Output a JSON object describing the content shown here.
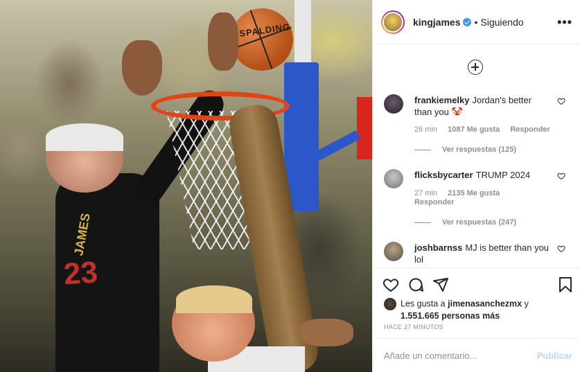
{
  "post": {
    "username": "kingjames",
    "follow_status": "Siguiendo",
    "more_icon": "more-options-icon",
    "image_text": "SPALDING"
  },
  "comments": [
    {
      "username": "frankiemelky",
      "text": "Jordan's better than you 🤡",
      "time": "26 min",
      "likes": "1087 Me gusta",
      "reply": "Responder",
      "view_replies": "Ver respuestas (125)"
    },
    {
      "username": "flicksbycarter",
      "text": "TRUMP 2024",
      "time": "27 min",
      "likes": "2135 Me gusta",
      "reply": "Responder",
      "view_replies": "Ver respuestas (247)"
    },
    {
      "username": "joshbarnss",
      "text": "MJ is better than you lol"
    }
  ],
  "likes_summary": {
    "prefix": "Les gusta a",
    "user": "jimenasanchezmx",
    "suffix": "y",
    "count": "1.551.665 personas más"
  },
  "timestamp": "HACE 27 MINUTOS",
  "add_comment": {
    "placeholder": "Añade un comentario...",
    "post_label": "Publicar"
  },
  "icons": {
    "like": "heart-icon",
    "comment": "comment-icon",
    "share": "send-icon",
    "save": "bookmark-icon",
    "load_more": "plus-circle-icon"
  },
  "colors": {
    "verified": "#3897f0",
    "publish_disabled": "#b3dbff",
    "muted_text": "#8e8e8e"
  }
}
